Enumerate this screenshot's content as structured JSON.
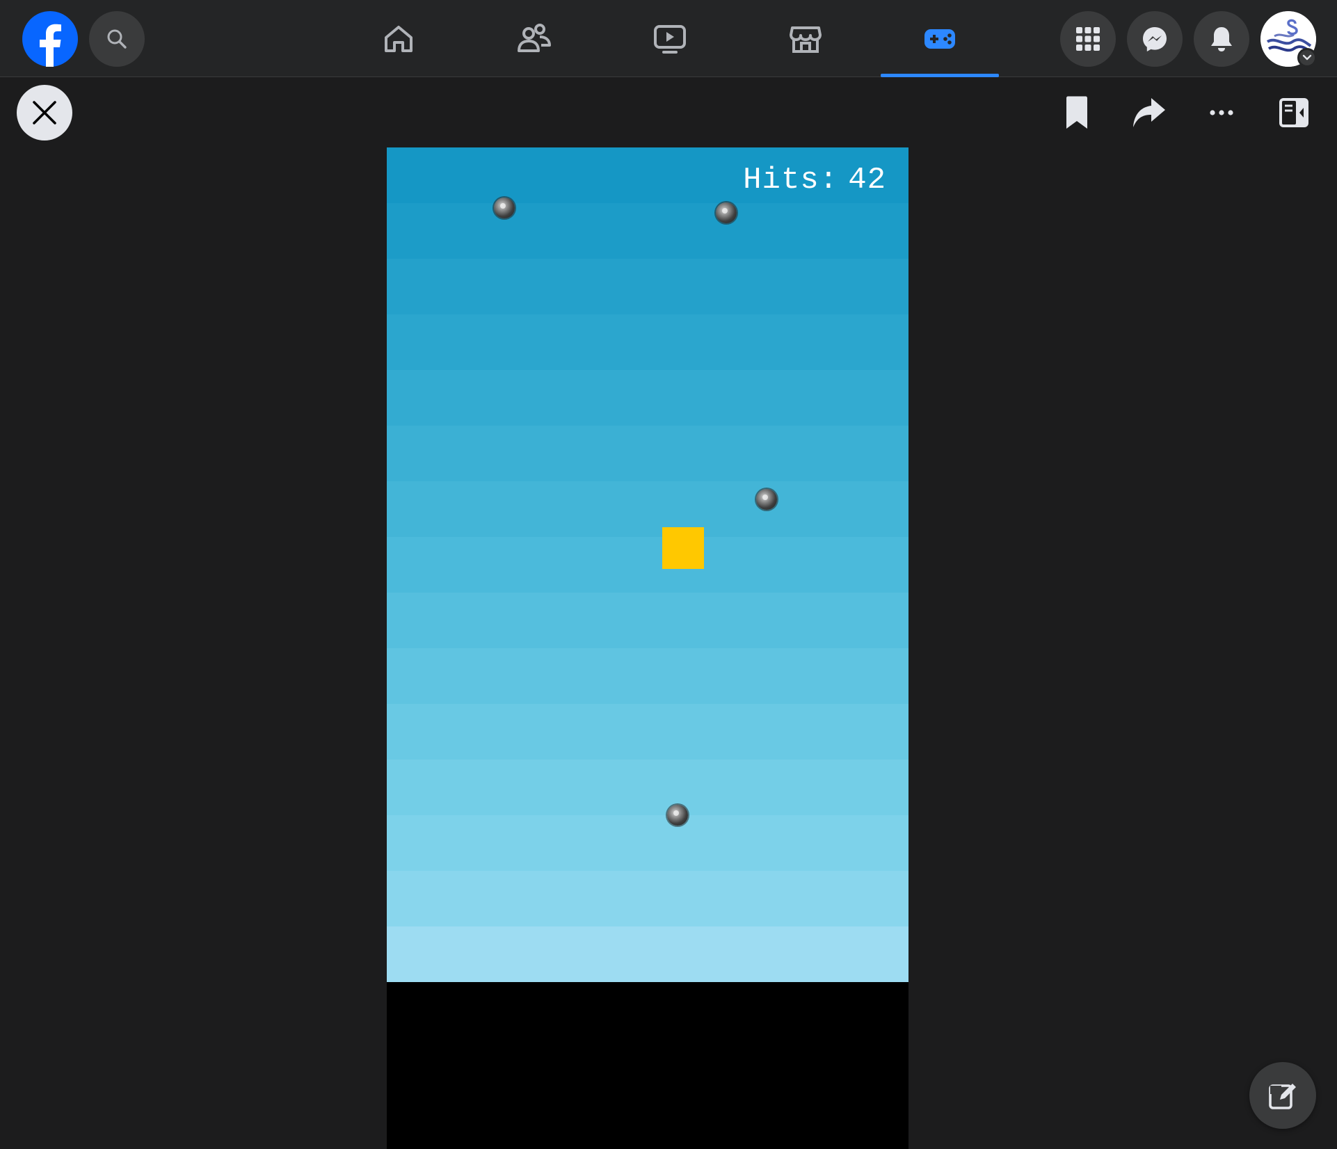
{
  "nav": {
    "logo_icon": "facebook-logo-icon",
    "search_icon": "search-icon",
    "tabs": [
      {
        "name": "home",
        "icon": "home-icon",
        "active": false
      },
      {
        "name": "friends",
        "icon": "friends-icon",
        "active": false
      },
      {
        "name": "watch",
        "icon": "video-icon",
        "active": false
      },
      {
        "name": "marketplace",
        "icon": "store-icon",
        "active": false
      },
      {
        "name": "gaming",
        "icon": "gamepad-icon",
        "active": true
      }
    ],
    "right_icons": [
      "menu-grid-icon",
      "messenger-icon",
      "bell-icon",
      "avatar"
    ],
    "accent_color": "#2d88ff",
    "brand_color": "#0866ff"
  },
  "viewer": {
    "close_icon": "close-icon",
    "toolbar_icons": [
      "bookmark-icon",
      "share-icon",
      "more-icon",
      "panel-toggle-icon"
    ]
  },
  "game": {
    "hud": {
      "hits_label": "Hits:",
      "hits_value": "42"
    },
    "player_color": "#ffc800",
    "sky_top_color": "#1597c5",
    "sky_bottom_color": "#9ddcf2",
    "obstacle_count_visible": 4
  },
  "compose": {
    "icon": "compose-icon"
  }
}
